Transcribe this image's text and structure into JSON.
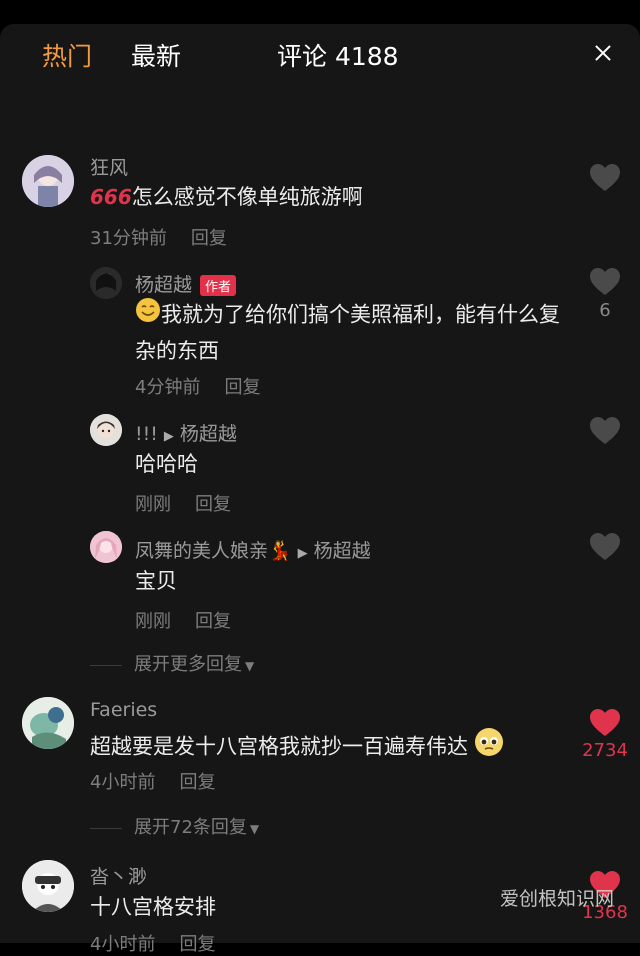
{
  "header": {
    "tab_hot": "热门",
    "tab_new": "最新",
    "title": "评论 4188",
    "close_icon": "close-icon"
  },
  "comments": [
    {
      "name": "狂风",
      "prefix": "666",
      "text": "怎么感觉不像单纯旅游啊",
      "time": "31分钟前",
      "reply": "回复",
      "replies": [
        {
          "name": "杨超越",
          "badge": "作者",
          "text": "我就为了给你们搞个美照福利，能有什么复杂的东西",
          "time": "4分钟前",
          "reply": "回复",
          "likes": "6"
        },
        {
          "name": "!!!",
          "to": "杨超越",
          "text": "哈哈哈",
          "time": "刚刚",
          "reply": "回复"
        },
        {
          "name": "凤舞的美人娘亲💃",
          "to": "杨超越",
          "text": "宝贝",
          "time": "刚刚",
          "reply": "回复"
        }
      ],
      "expand": "展开更多回复"
    },
    {
      "name": "Faeries",
      "text": "超越要是发十八宫格我就抄一百遍寿伟达",
      "time": "4小时前",
      "reply": "回复",
      "likes": "2734",
      "expand": "展开72条回复"
    },
    {
      "name": "沓丶渺",
      "text": "十八宫格安排",
      "time": "4小时前",
      "reply": "回复",
      "likes": "1368"
    }
  ],
  "colors": {
    "accent": "#f39c3d",
    "like_red": "#e0344c",
    "badge": "#e4314a"
  },
  "watermark": "爱创根知识网"
}
